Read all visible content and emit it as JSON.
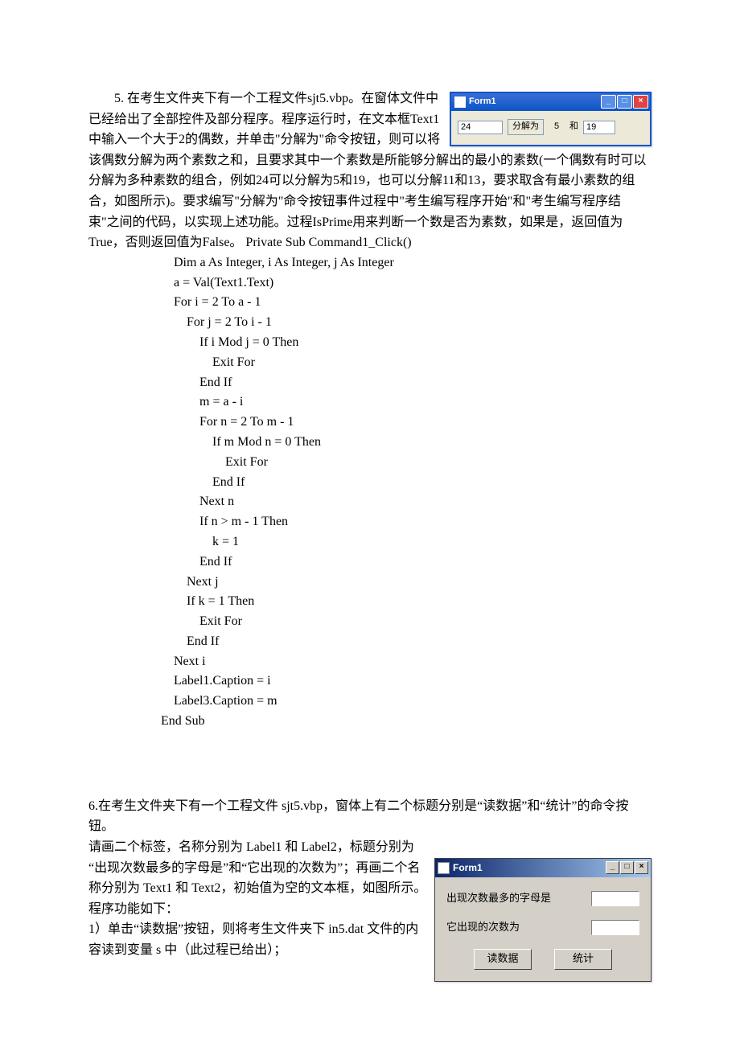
{
  "q5": {
    "prefix": "5. ",
    "text": "在考生文件夹下有一个工程文件sjt5.vbp。在窗体文件中已经给出了全部控件及部分程序。程序运行时，在文本框Text1中输入一个大于2的偶数，并单击\"分解为\"命令按钮，则可以将该偶数分解为两个素数之和，且要求其中一个素数是所能够分解出的最小的素数(一个偶数有时可以分解为多种素数的组合，例如24可以分解为5和19，也可以分解11和13，要求取含有最小素数的组合，如图所示)。要求编写\"分解为\"命令按钮事件过程中\"考生编写程序开始\"和\"考生编写程序结束\"之间的代码，以实现上述功能。过程IsPrime用来判断一个数是否为素数，如果是，返回值为True，否则返回值为False。   Private Sub Command1_Click()",
    "code": "    Dim a As Integer, i As Integer, j As Integer\n    a = Val(Text1.Text)\n    For i = 2 To a - 1\n        For j = 2 To i - 1\n            If i Mod j = 0 Then\n                Exit For\n            End If\n            m = a - i\n            For n = 2 To m - 1\n                If m Mod n = 0 Then\n                    Exit For\n                End If\n            Next n\n            If n > m - 1 Then\n                k = 1\n            End If\n        Next j\n        If k = 1 Then\n            Exit For\n        End If\n    Next i\n    Label1.Caption = i\n    Label3.Caption = m\nEnd Sub"
  },
  "form5": {
    "title": "Form1",
    "text1": "24",
    "btn": "分解为",
    "label1": "5",
    "label2": "和",
    "label3": "19"
  },
  "q6": {
    "line1": "6.在考生文件夹下有一个工程文件 sjt5.vbp，窗体上有二个标题分别是“读数据”和“统计”的命令按钮。",
    "line2": "请画二个标签，名称分别为 Label1 和 Label2，标题分别为",
    "line3": "“出现次数最多的字母是”和“它出现的次数为”；再画二个名称分别为 Text1 和 Text2，初始值为空的文本框，如图所示。程序功能如下：",
    "line4": " 1）单击“读数据”按钮，则将考生文件夹下 in5.dat 文件的内容读到变量 s 中（此过程已给出）；"
  },
  "form6": {
    "title": "Form1",
    "label1": "出现次数最多的字母是",
    "label2": "它出现的次数为",
    "btn1": "读数据",
    "btn2": "统计"
  }
}
